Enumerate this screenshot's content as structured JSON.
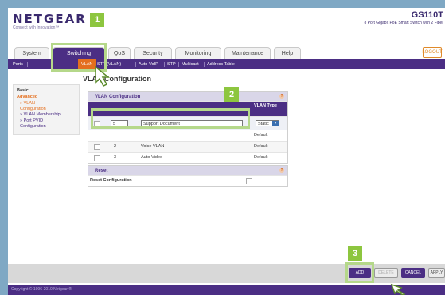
{
  "brand": {
    "logo": "NETGEAR",
    "tagline": "Connect with Innovation™"
  },
  "device": {
    "model": "GS110T",
    "description": "8 Port Gigabit PoE Smart Switch with 2 Fiber"
  },
  "tabs": [
    "System",
    "Switching",
    "QoS",
    "Security",
    "Monitoring",
    "Maintenance",
    "Help"
  ],
  "active_tab": "Switching",
  "logout_label": "LOGOUT",
  "subnav": [
    "Ports",
    "VLAN",
    "STP (VLAN)",
    "Auto-VoIP",
    "STP",
    "Multicast",
    "Address Table"
  ],
  "left_menu": {
    "basic": "Basic",
    "advanced": "Advanced",
    "items": [
      "» VLAN Configuration",
      "» VLAN Membership",
      "» Port PVID Configuration"
    ]
  },
  "page_title": "VLAN Configuration",
  "vlan_panel": {
    "title": "VLAN Configuration",
    "col_type": "VLAN Type",
    "new_row": {
      "id": "5",
      "name": "Support Document",
      "type": "Static"
    },
    "rows": [
      {
        "id": "",
        "name": "",
        "type": "Default"
      },
      {
        "id": "2",
        "name": "Voice VLAN",
        "type": "Default"
      },
      {
        "id": "3",
        "name": "Auto-Video",
        "type": "Default"
      }
    ]
  },
  "reset_panel": {
    "title": "Reset",
    "label": "Reset Configuration"
  },
  "help_glyph": "?",
  "buttons": {
    "add": "ADD",
    "delete": "DELETE",
    "cancel": "CANCEL",
    "apply": "APPLY"
  },
  "callouts": [
    "1",
    "2",
    "3"
  ],
  "copyright": "Copyright © 1996-2010 Netgear ®",
  "colors": {
    "brand": "#4b2e84",
    "accent": "#e46f1e",
    "callout": "#8dc63f"
  }
}
